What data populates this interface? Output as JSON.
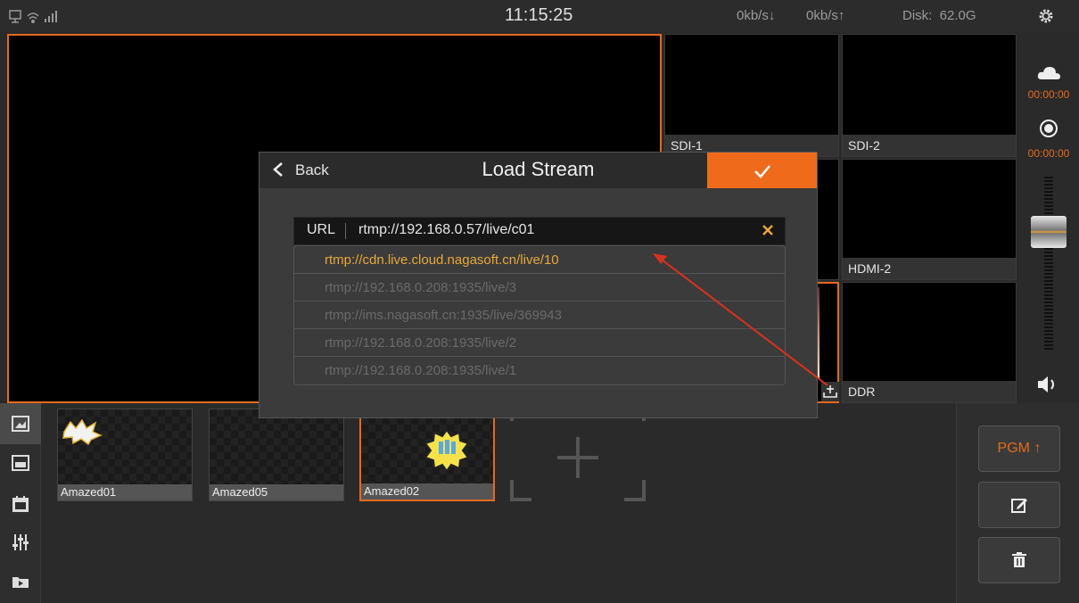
{
  "status": {
    "clock": "11:15:25",
    "download_rate": "0kb/s↓",
    "upload_rate": "0kb/s↑",
    "disk": "Disk:  62.0G",
    "icons": [
      "monitor-icon",
      "wifi-icon",
      "signal-icon",
      "settings-gear-icon"
    ]
  },
  "sources": [
    {
      "label": "SDI-1"
    },
    {
      "label": "SDI-2"
    },
    {
      "label": "HDMI-2"
    },
    {
      "label": "DDR"
    }
  ],
  "right_strip": {
    "stream_timer": "00:00:00",
    "record_timer": "00:00:00"
  },
  "overlays": [
    {
      "label": "Amazed01"
    },
    {
      "label": "Amazed05"
    },
    {
      "label": "Amazed02"
    }
  ],
  "right_panel": {
    "pgm_label": "PGM ↑"
  },
  "dialog": {
    "back_label": "Back",
    "title": "Load Stream",
    "url_label": "URL",
    "url_value": "rtmp://192.168.0.57/live/c01",
    "history": [
      "rtmp://cdn.live.cloud.nagasoft.cn/live/10",
      "rtmp://192.168.0.208:1935/live/3",
      "rtmp://ims.nagasoft.cn:1935/live/369943",
      "rtmp://192.168.0.208:1935/live/2",
      "rtmp://192.168.0.208:1935/live/1"
    ]
  },
  "colors": {
    "accent": "#f06a1c",
    "highlight": "#e9a83a",
    "background": "#2a2a2a"
  }
}
